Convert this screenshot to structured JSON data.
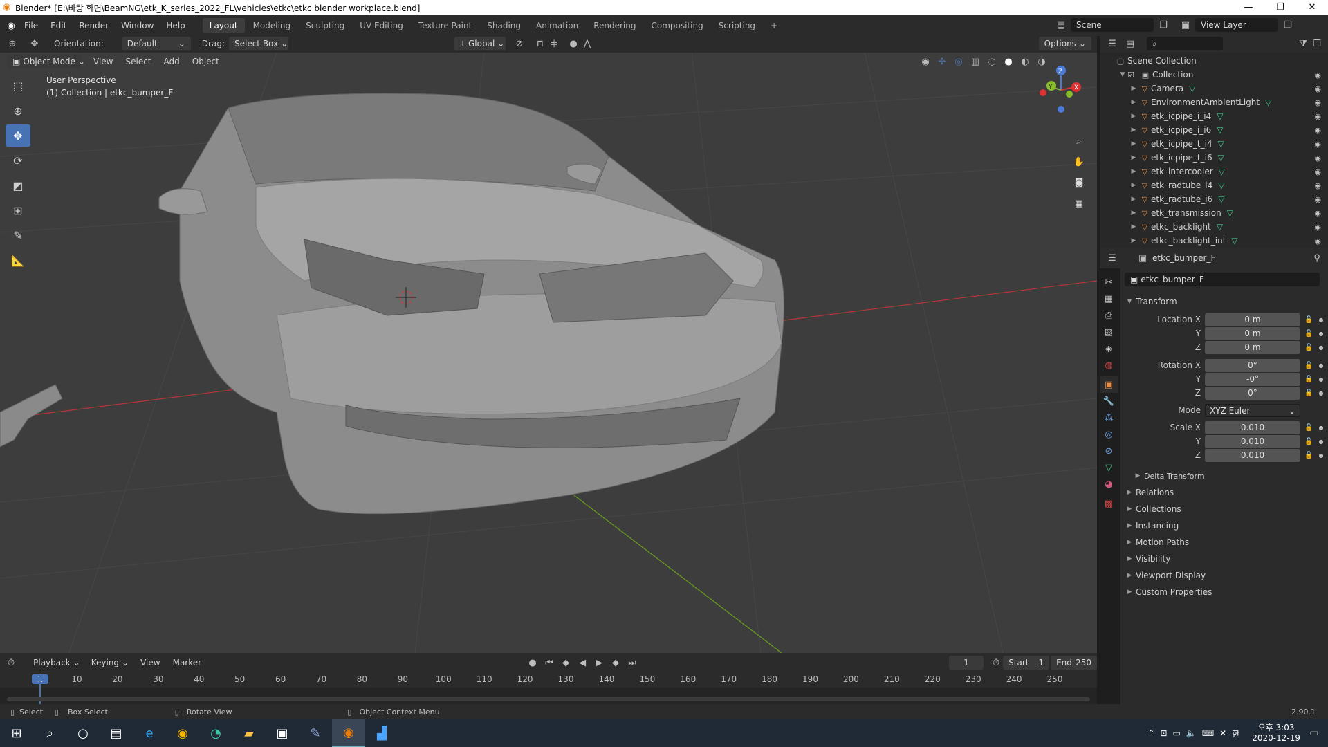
{
  "window": {
    "title": "Blender* [E:\\바탕 화면\\BeamNG\\etk_K_series_2022_FL\\vehicles\\etkc\\etkc blender workplace.blend]",
    "minimize": "—",
    "maximize": "❐",
    "close": "✕"
  },
  "menu": [
    "File",
    "Edit",
    "Render",
    "Window",
    "Help"
  ],
  "workspaces": {
    "active": "Layout",
    "tabs": [
      "Layout",
      "Modeling",
      "Sculpting",
      "UV Editing",
      "Texture Paint",
      "Shading",
      "Animation",
      "Rendering",
      "Compositing",
      "Scripting"
    ],
    "add": "+"
  },
  "scene": {
    "name": "Scene",
    "view_layer": "View Layer"
  },
  "tool_header": {
    "orientation_label": "Orientation:",
    "orientation_value": "Default",
    "drag_label": "Drag:",
    "drag_value": "Select Box",
    "transform_orientation": "Global",
    "options": "Options"
  },
  "viewport_header": {
    "mode": "Object Mode",
    "menus": [
      "View",
      "Select",
      "Add",
      "Object"
    ]
  },
  "viewport": {
    "perspective": "User Perspective",
    "collection_info": "(1) Collection | etkc_bumper_F",
    "gizmo_axes": [
      "Z",
      "Y",
      "X"
    ]
  },
  "outliner": {
    "search_placeholder": "",
    "root": "Scene Collection",
    "collection": "Collection",
    "items": [
      {
        "name": "Camera",
        "icon": "camera-icon",
        "badge": "camera-data-icon"
      },
      {
        "name": "EnvironmentAmbientLight",
        "icon": "light-icon",
        "badge": "light-data-icon"
      },
      {
        "name": "etk_icpipe_i_i4",
        "icon": "mesh-object-icon",
        "badge": "mesh-data-icon"
      },
      {
        "name": "etk_icpipe_i_i6",
        "icon": "mesh-object-icon",
        "badge": "mesh-data-icon"
      },
      {
        "name": "etk_icpipe_t_i4",
        "icon": "mesh-object-icon",
        "badge": "mesh-data-icon"
      },
      {
        "name": "etk_icpipe_t_i6",
        "icon": "mesh-object-icon",
        "badge": "mesh-data-icon"
      },
      {
        "name": "etk_intercooler",
        "icon": "mesh-object-icon",
        "badge": "mesh-data-icon"
      },
      {
        "name": "etk_radtube_i4",
        "icon": "mesh-object-icon",
        "badge": "mesh-data-icon"
      },
      {
        "name": "etk_radtube_i6",
        "icon": "mesh-object-icon",
        "badge": "mesh-data-icon"
      },
      {
        "name": "etk_transmission",
        "icon": "mesh-object-icon",
        "badge": "mesh-data-icon"
      },
      {
        "name": "etkc_backlight",
        "icon": "mesh-object-icon",
        "badge": "mesh-data-icon"
      },
      {
        "name": "etkc_backlight_int",
        "icon": "mesh-object-icon",
        "badge": "mesh-data-icon"
      }
    ]
  },
  "properties": {
    "context_object": "etkc_bumper_F",
    "object_name": "etkc_bumper_F",
    "transform": {
      "title": "Transform",
      "location_label": "Location X",
      "location": [
        "0 m",
        "0 m",
        "0 m"
      ],
      "rotation_label": "Rotation X",
      "rotation": [
        "0°",
        "-0°",
        "0°"
      ],
      "mode_label": "Mode",
      "mode_value": "XYZ Euler",
      "scale_label": "Scale X",
      "scale": [
        "0.010",
        "0.010",
        "0.010"
      ],
      "y": "Y",
      "z": "Z",
      "delta": "Delta Transform"
    },
    "panels": [
      "Relations",
      "Collections",
      "Instancing",
      "Motion Paths",
      "Visibility",
      "Viewport Display",
      "Custom Properties"
    ]
  },
  "timeline": {
    "menus": [
      "Playback",
      "Keying",
      "View",
      "Marker"
    ],
    "current_frame": "1",
    "start_label": "Start",
    "start": "1",
    "end_label": "End",
    "end": "250",
    "ticks": [
      "1",
      "10",
      "20",
      "30",
      "40",
      "50",
      "60",
      "70",
      "80",
      "90",
      "100",
      "110",
      "120",
      "130",
      "140",
      "150",
      "160",
      "170",
      "180",
      "190",
      "200",
      "210",
      "220",
      "230",
      "240",
      "250"
    ]
  },
  "statusbar": {
    "select": "Select",
    "box_select": "Box Select",
    "rotate_view": "Rotate View",
    "context_menu": "Object Context Menu",
    "version": "2.90.1"
  },
  "taskbar": {
    "time": "오후 3:03",
    "date": "2020-12-19"
  },
  "colors": {
    "accent": "#4772b3",
    "viewport_bg": "#3d3d3d",
    "object_orange": "#e8904a",
    "x_axis": "#c0393b",
    "y_axis": "#6a9a1f"
  }
}
